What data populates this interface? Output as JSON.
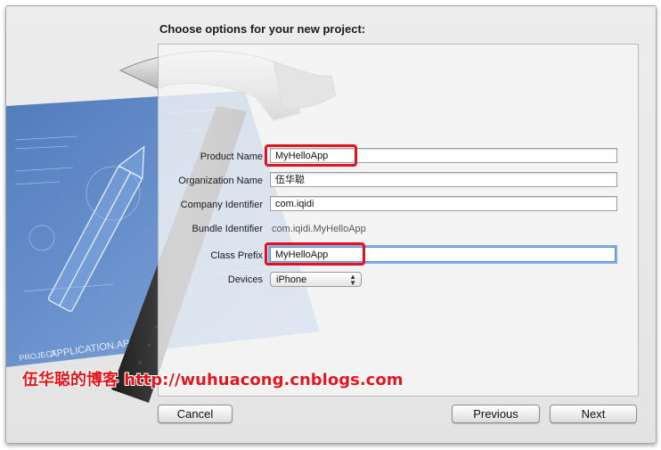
{
  "dialog": {
    "title": "Choose options for your new project:"
  },
  "form": {
    "product_name": {
      "label": "Product Name",
      "value": "MyHelloApp"
    },
    "organization_name": {
      "label": "Organization Name",
      "value": "伍华聪"
    },
    "company_identifier": {
      "label": "Company Identifier",
      "value": "com.iqidi"
    },
    "bundle_identifier": {
      "label": "Bundle Identifier",
      "value": "com.iqidi.MyHelloApp"
    },
    "class_prefix": {
      "label": "Class Prefix",
      "value": "MyHelloApp"
    },
    "devices": {
      "label": "Devices",
      "selected": "iPhone"
    }
  },
  "art": {
    "blueprint_text": "APPLICATION.APP",
    "blueprint_project": "PROJECT"
  },
  "watermark": "伍华聪的博客 http://wuhuacong.cnblogs.com",
  "buttons": {
    "cancel": "Cancel",
    "previous": "Previous",
    "next": "Next"
  },
  "colors": {
    "highlight": "#e8101a",
    "focus_ring": "#86aee6",
    "blueprint": "#5b86c8"
  },
  "icons": {
    "popup_arrows": "updown-arrows-icon"
  }
}
